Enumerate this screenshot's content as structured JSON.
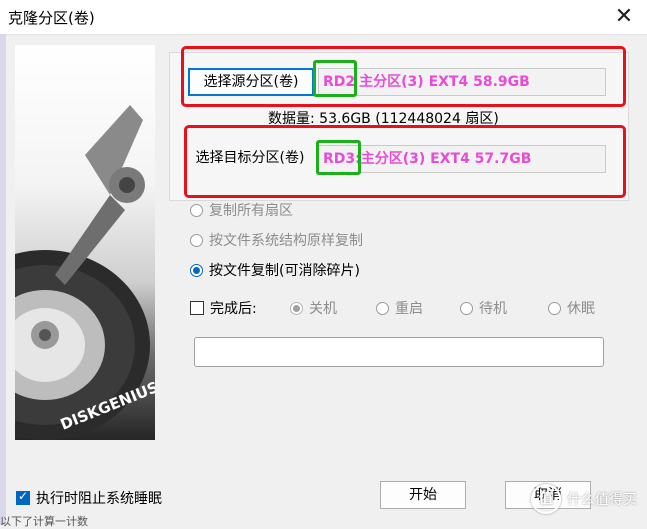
{
  "window": {
    "title": "克隆分区(卷)",
    "close_glyph": "✕"
  },
  "side_image": {
    "brand_text": "DISKGENIUS"
  },
  "source": {
    "button_label": "选择源分区(卷)",
    "highlight": "RD2",
    "info": "主分区(3) EXT4 58.9GB"
  },
  "data_amount": "数据量: 53.6GB (112448024 扇区)",
  "target": {
    "button_label": "选择目标分区(卷)",
    "highlight": "RD3:",
    "info": "主分区(3) EXT4 57.7GB"
  },
  "copy_modes": [
    {
      "label": "复制所有扇区",
      "enabled": false,
      "checked": false
    },
    {
      "label": "按文件系统结构原样复制",
      "enabled": false,
      "checked": false
    },
    {
      "label": "按文件复制(可消除碎片)",
      "enabled": true,
      "checked": true
    }
  ],
  "after_complete": {
    "label": "完成后:",
    "checked": false,
    "options": [
      {
        "label": "关机",
        "checked": true
      },
      {
        "label": "重启",
        "checked": false
      },
      {
        "label": "待机",
        "checked": false
      },
      {
        "label": "休眠",
        "checked": false
      }
    ]
  },
  "prevent_sleep": {
    "label": "执行时阻止系统睡眠",
    "checked": true
  },
  "buttons": {
    "start": "开始",
    "cancel": "取消"
  },
  "watermark": {
    "icon_text": "值",
    "text": "什么值得买"
  },
  "bottom_partial_text": "以下了计算一计数"
}
